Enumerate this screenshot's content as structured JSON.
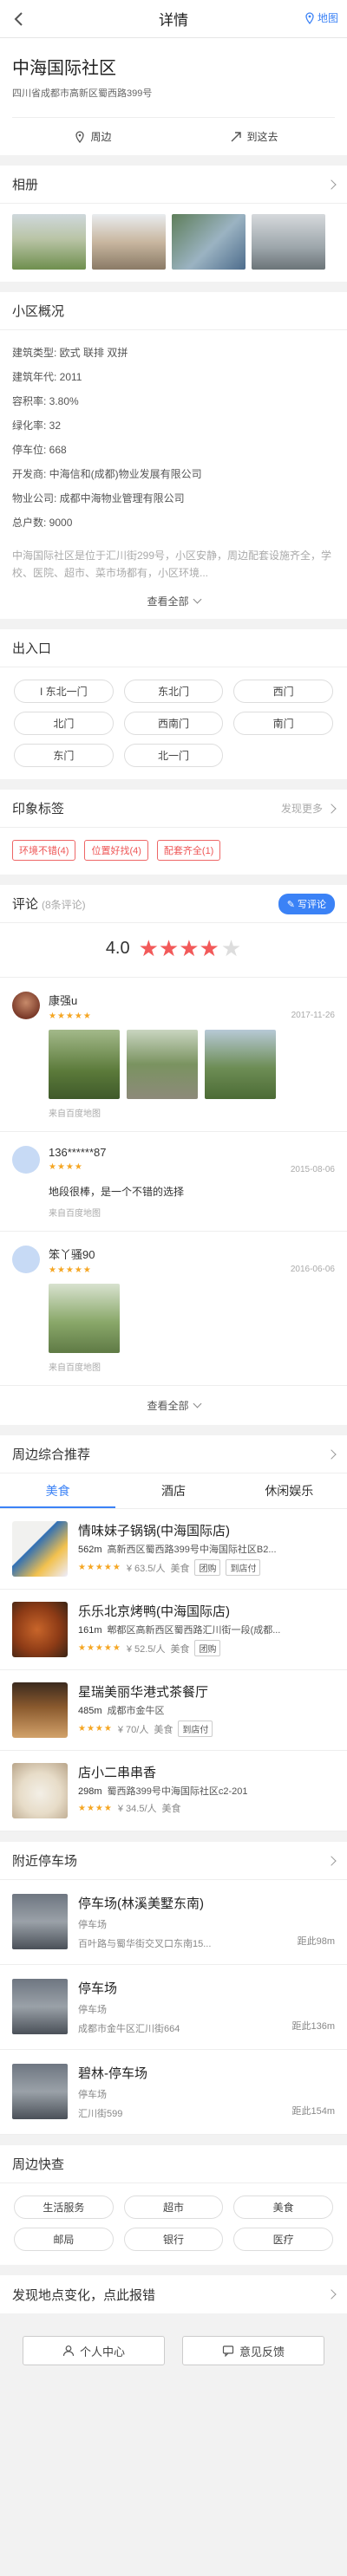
{
  "nav": {
    "title": "详情",
    "map_label": "地图"
  },
  "header": {
    "name": "中海国际社区",
    "address": "四川省成都市高新区蜀西路399号",
    "nearby_label": "周边",
    "goto_label": "到这去"
  },
  "album": {
    "title": "相册"
  },
  "overview": {
    "title": "小区概况",
    "items": [
      "建筑类型: 欧式 联排 双拼",
      "建筑年代: 2011",
      "容积率: 3.80%",
      "绿化率: 32",
      "停车位: 668",
      "开发商: 中海信和(成都)物业发展有限公司",
      "物业公司: 成都中海物业管理有限公司",
      "总户数: 9000"
    ],
    "desc": "中海国际社区是位于汇川街299号，小区安静，周边配套设施齐全，学校、医院、超市、菜市场都有，小区环境...",
    "more_label": "查看全部"
  },
  "gates": {
    "title": "出入口",
    "items": [
      "I 东北一门",
      "东北门",
      "西门",
      "北门",
      "西南门",
      "南门",
      "东门",
      "北一门"
    ]
  },
  "impress": {
    "title": "印象标签",
    "more_label": "发现更多",
    "tags": [
      "环境不错(4)",
      "位置好找(4)",
      "配套齐全(1)"
    ]
  },
  "reviews": {
    "title": "评论",
    "count": "(8条评论)",
    "write_label": "写评论",
    "score": "4.0",
    "stars_full": "★★★★",
    "star_empty": "★",
    "items": [
      {
        "name": "康强u",
        "date": "2017-11-26",
        "stars": "★★★★★",
        "text": "",
        "source": "来自百度地图"
      },
      {
        "name": "136******87",
        "date": "2015-08-06",
        "stars": "★★★★",
        "text": "地段很棒，是一个不错的选择",
        "source": "来自百度地图"
      },
      {
        "name": "笨丫骚90",
        "date": "2016-06-06",
        "stars": "★★★★★",
        "text": "",
        "source": "来自百度地图"
      }
    ],
    "more_label": "查看全部"
  },
  "recommend": {
    "title": "周边综合推荐",
    "tabs": [
      "美食",
      "酒店",
      "休闲娱乐"
    ],
    "items": [
      {
        "name": "情味妹子锅锅(中海国际店)",
        "dist": "562m",
        "addr": "高新西区蜀西路399号中海国际社区B2...",
        "stars": "★★★★★",
        "price": "¥ 63.5/人",
        "cat": "美食",
        "pills": [
          "团购",
          "到店付"
        ]
      },
      {
        "name": "乐乐北京烤鸭(中海国际店)",
        "dist": "161m",
        "addr": "郫都区高新西区蜀西路汇川街一段(成都...",
        "stars": "★★★★★",
        "price": "¥ 52.5/人",
        "cat": "美食",
        "pills": [
          "团购"
        ]
      },
      {
        "name": "星瑞美丽华港式茶餐厅",
        "dist": "485m",
        "addr": "成都市金牛区",
        "stars": "★★★★",
        "price": "¥ 70/人",
        "cat": "美食",
        "pills": [
          "到店付"
        ]
      },
      {
        "name": "店小二串串香",
        "dist": "298m",
        "addr": "蜀西路399号中海国际社区c2-201",
        "stars": "★★★★",
        "price": "¥ 34.5/人",
        "cat": "美食",
        "pills": []
      }
    ]
  },
  "parking": {
    "title": "附近停车场",
    "items": [
      {
        "name": "停车场(林溪美墅东南)",
        "type": "停车场",
        "addr": "百叶路与蜀华街交叉口东南15...",
        "dist": "距此98m"
      },
      {
        "name": "停车场",
        "type": "停车场",
        "addr": "成都市金牛区汇川街664",
        "dist": "距此136m"
      },
      {
        "name": "碧林-停车场",
        "type": "停车场",
        "addr": "汇川街599",
        "dist": "距此154m"
      }
    ]
  },
  "quick": {
    "title": "周边快查",
    "items": [
      "生活服务",
      "超市",
      "美食",
      "邮局",
      "银行",
      "医疗"
    ]
  },
  "report": {
    "title": "发现地点变化，点此报错"
  },
  "footer": {
    "center_label": "个人中心",
    "feedback_label": "意见反馈"
  },
  "colors": {
    "accent": "#3b82f6",
    "star": "#f25a5a",
    "tag": "#e55555"
  }
}
